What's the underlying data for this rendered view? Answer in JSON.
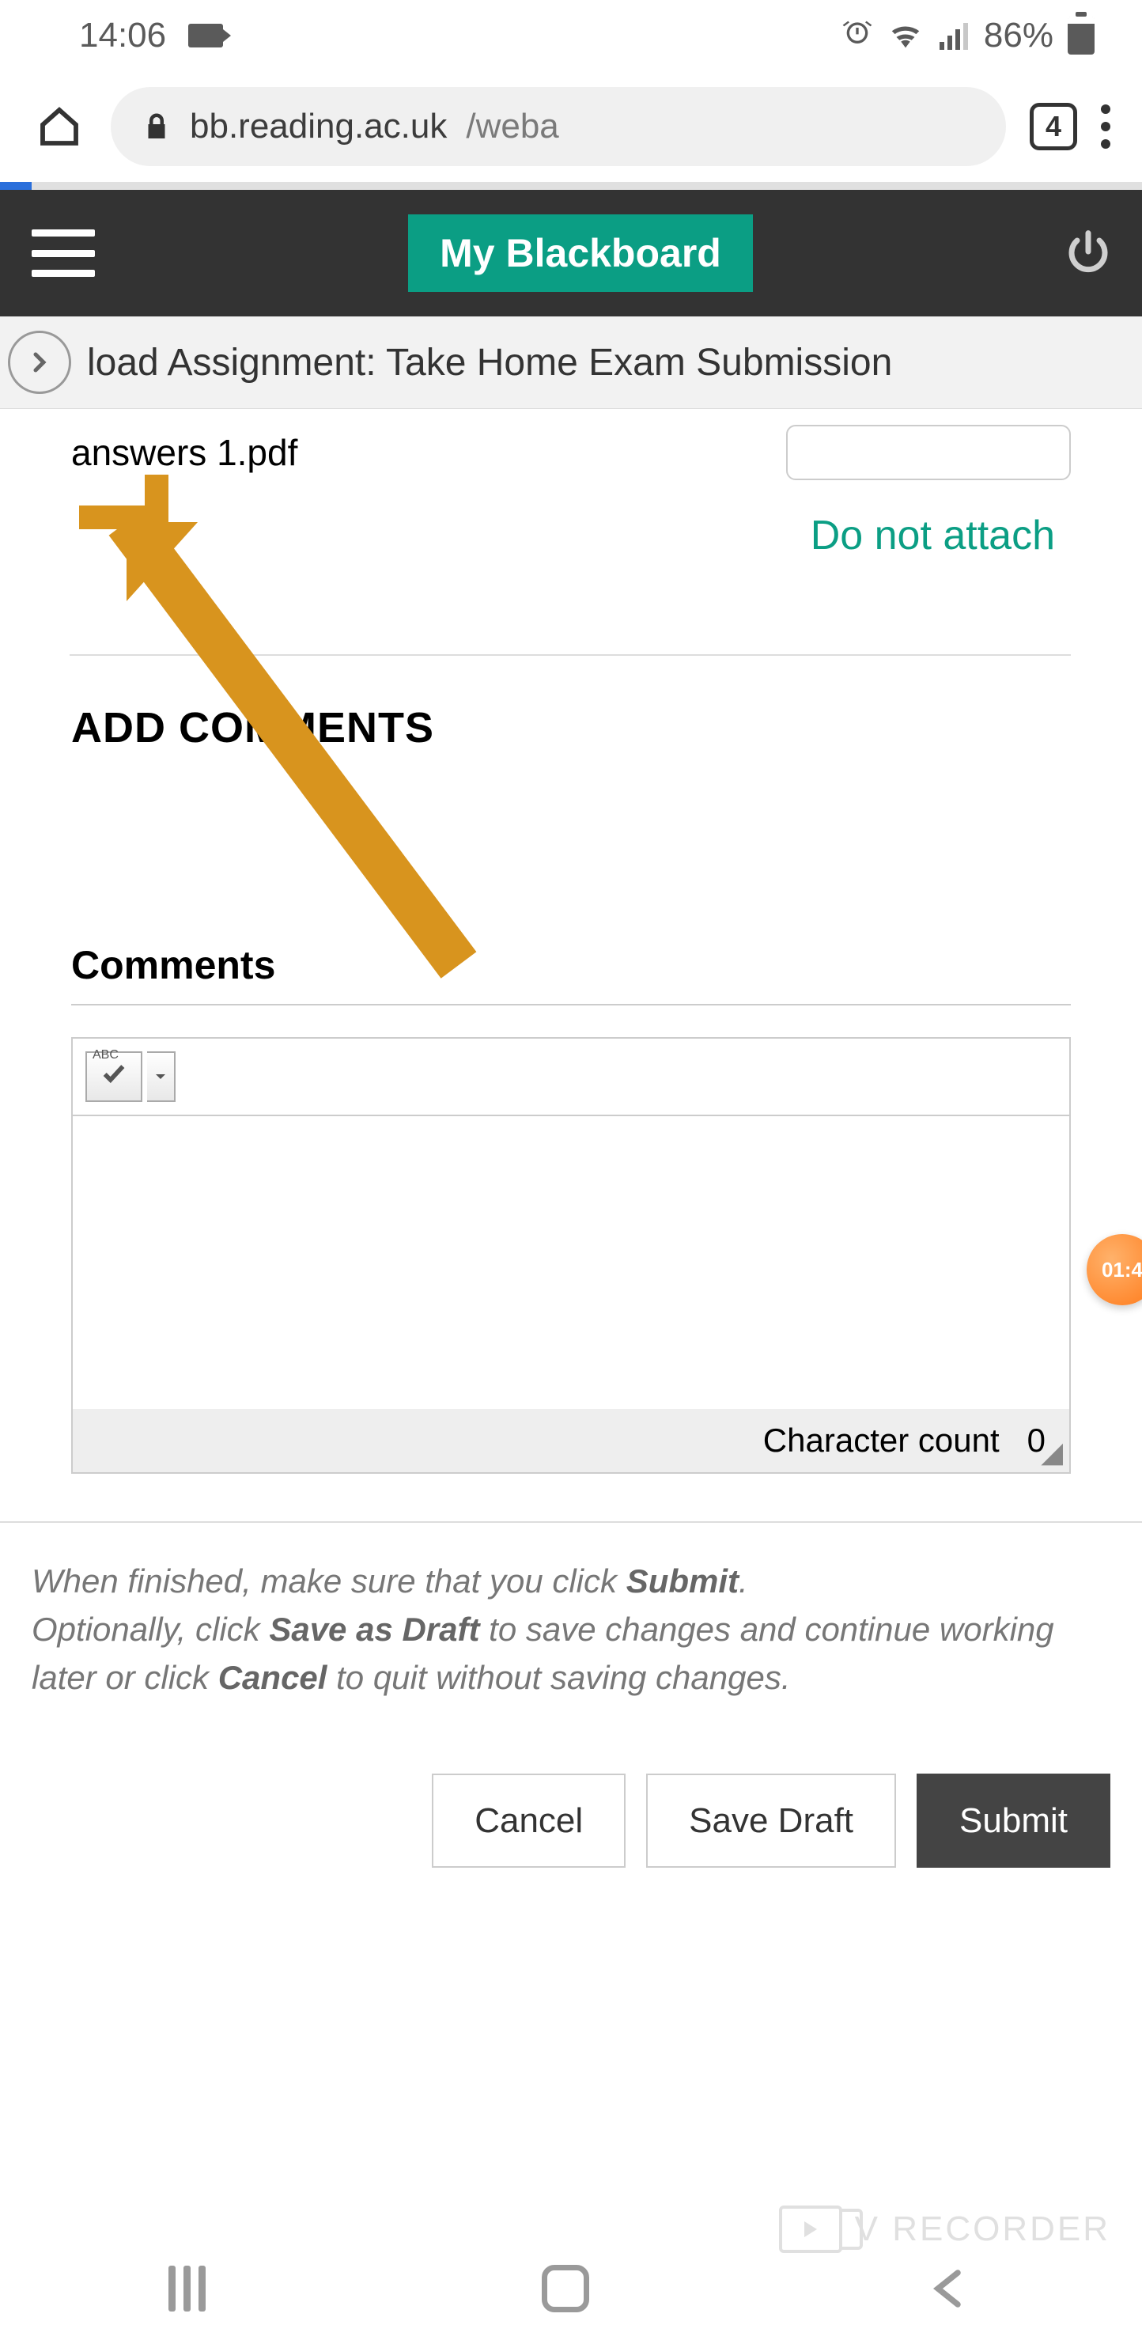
{
  "status": {
    "time": "14:06",
    "battery_pct": "86%"
  },
  "browser": {
    "host": "bb.reading.ac.uk",
    "path_tail": "/weba",
    "tab_count": "4"
  },
  "bb_header": {
    "title": "My Blackboard"
  },
  "page": {
    "title_visible": "load Assignment: Take Home Exam Submission"
  },
  "file": {
    "name": "answers 1.pdf",
    "attach_label": "attach"
  },
  "comments": {
    "section_head": "ADD COMMENTS",
    "field_label": "Comments",
    "toolbar_btn": "ABC",
    "char_count_label": "Character count",
    "char_count_value": "0"
  },
  "footer": {
    "line1_pre": "When finished, make sure that you click ",
    "line1_b": "Submit",
    "line1_post": ".",
    "line2_pre": "Optionally, click ",
    "line2_b1": "Save as Draft",
    "line2_mid": " to save changes and continue working later or click ",
    "line2_b2": "Cancel",
    "line2_post": " to quit without saving changes.",
    "btn_cancel": "Cancel",
    "btn_draft": "Save Draft",
    "btn_submit": "Submit"
  },
  "recorder": {
    "bubble": "01:4",
    "watermark": "V RECORDER"
  }
}
